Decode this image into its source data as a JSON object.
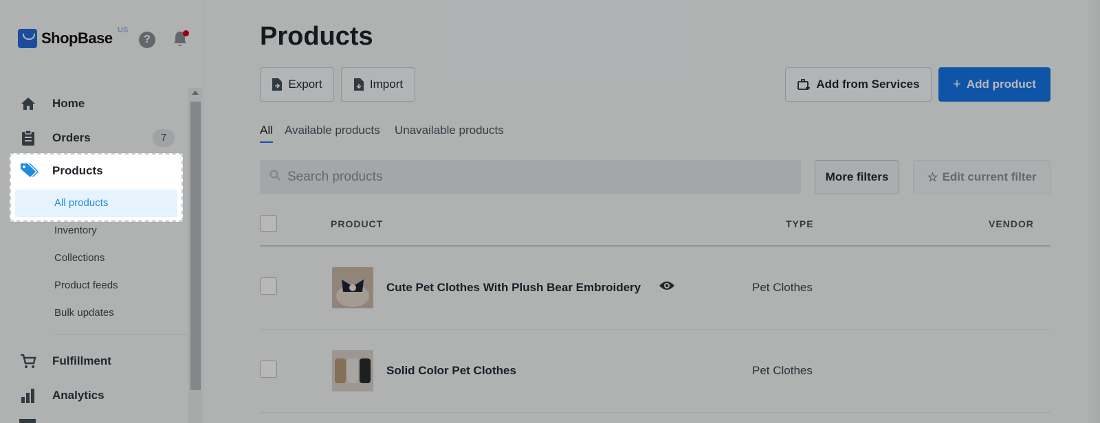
{
  "brand": {
    "name": "ShopBase",
    "region": "US"
  },
  "colors": {
    "accent": "#1576e8",
    "active_bg": "#e6f3fd",
    "active_text": "#1d8de0",
    "notification_dot": "#d0021b"
  },
  "sidebar": {
    "items": [
      {
        "label": "Home",
        "icon": "home-icon"
      },
      {
        "label": "Orders",
        "icon": "clipboard-icon",
        "badge": "7"
      },
      {
        "label": "Products",
        "icon": "tag-icon"
      },
      {
        "label": "Fulfillment",
        "icon": "cart-icon"
      },
      {
        "label": "Analytics",
        "icon": "bar-chart-icon"
      }
    ],
    "product_sub": [
      "All products",
      "Inventory",
      "Collections",
      "Product feeds",
      "Bulk updates"
    ]
  },
  "main": {
    "title": "Products",
    "buttons": {
      "export": "Export",
      "import": "Import",
      "add_services": "Add from Services",
      "add_product": "Add product"
    },
    "tabs": [
      "All",
      "Available products",
      "Unavailable products"
    ],
    "search": {
      "placeholder": "Search products"
    },
    "more_filters": "More filters",
    "edit_filter": "Edit current filter",
    "table": {
      "columns": [
        "PRODUCT",
        "TYPE",
        "VENDOR"
      ],
      "rows": [
        {
          "name": "Cute Pet Clothes With Plush Bear Embroidery",
          "type": "Pet Clothes",
          "vendor": ""
        },
        {
          "name": "Solid Color Pet Clothes",
          "type": "Pet Clothes",
          "vendor": ""
        }
      ]
    }
  }
}
